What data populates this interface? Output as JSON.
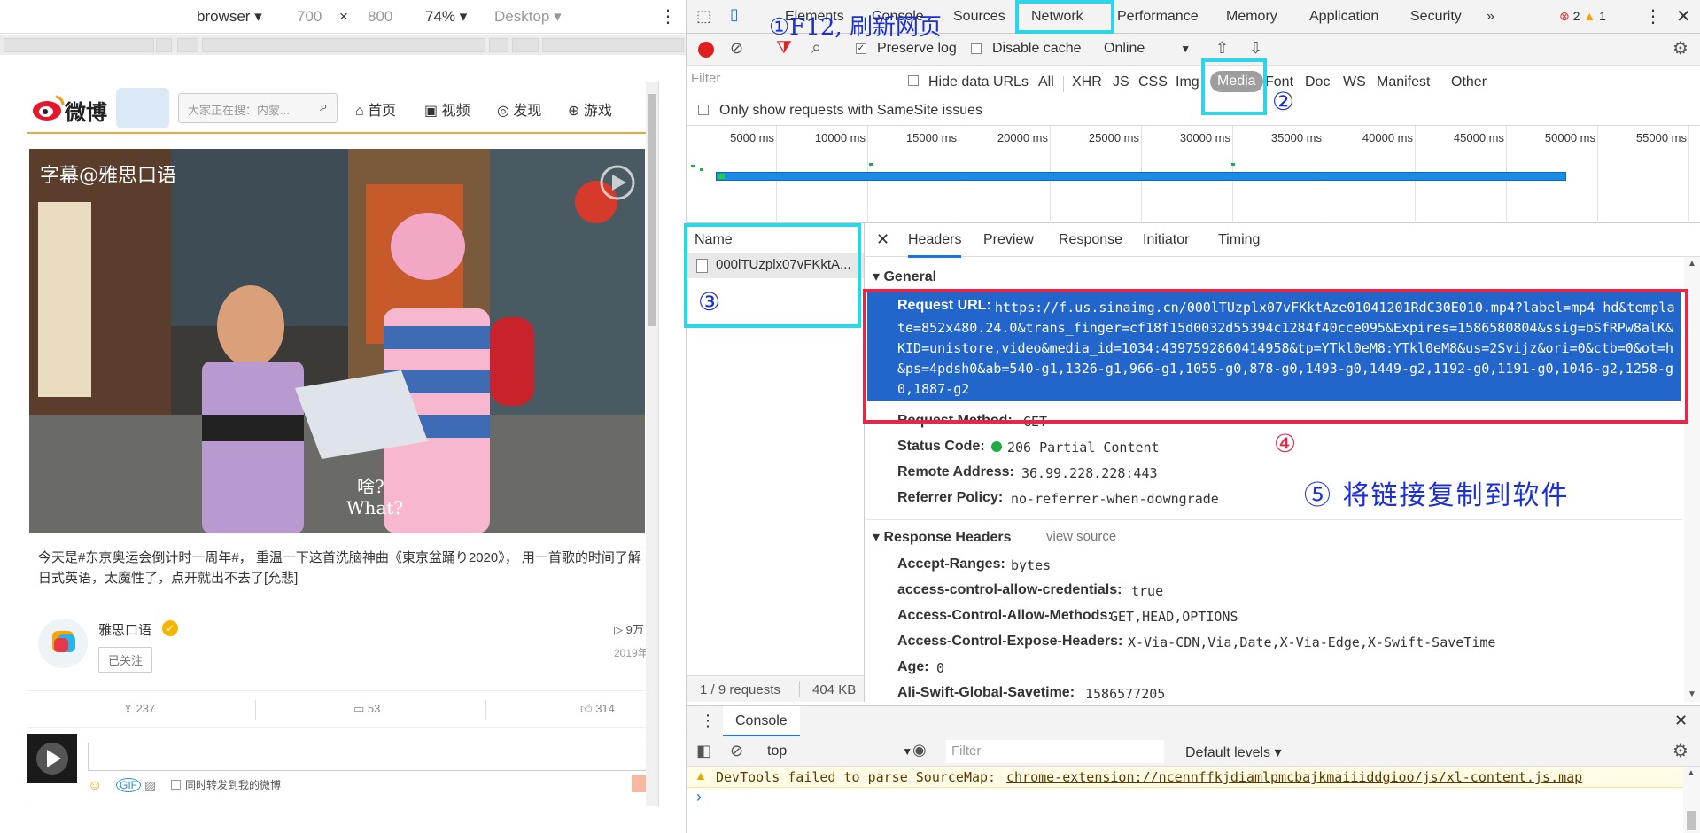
{
  "device_bar": {
    "device": "browser",
    "width": "700",
    "times": "×",
    "height": "800",
    "zoom": "74%",
    "mode": "Desktop"
  },
  "weibo": {
    "logo_text": "微博",
    "search_placeholder": "大家正在搜：内蒙...",
    "nav": [
      "首页",
      "视频",
      "发现",
      "游戏"
    ],
    "video_subtitle_top": "字幕@雅思口语",
    "video_subtitle_cn": "啥?",
    "video_subtitle_en": "What?",
    "post_text": "今天是#东京奥运会倒计时一周年#， 重温一下这首洗脑神曲《東京盆踊り2020》， 用一首歌的时间了解日式英语，太魔性了，点开就出不去了[允悲]",
    "username": "雅思口语",
    "follow_button": "已关注",
    "play_count": "▷ 9万",
    "date": "2019年",
    "repost_count": "237",
    "comment_count": "53",
    "like_count": "314",
    "sync_repost_label": "同时转发到我的微博"
  },
  "devtools": {
    "tabs": [
      "Elements",
      "Console",
      "Sources",
      "Network",
      "Performance",
      "Memory",
      "Application",
      "Security",
      "»"
    ],
    "error_count": "2",
    "warning_count": "1",
    "toolbar": {
      "preserve_log": "Preserve log",
      "disable_cache": "Disable cache",
      "throttle": "Online"
    },
    "filter": {
      "placeholder": "Filter",
      "hide_data_urls": "Hide data URLs",
      "types": [
        "All",
        "XHR",
        "JS",
        "CSS",
        "Img",
        "Media",
        "Font",
        "Doc",
        "WS",
        "Manifest",
        "Other"
      ],
      "selected_type": "Media",
      "samesite": "Only show requests with SameSite issues"
    },
    "timeline_ticks": [
      "5000 ms",
      "10000 ms",
      "15000 ms",
      "20000 ms",
      "25000 ms",
      "30000 ms",
      "35000 ms",
      "40000 ms",
      "45000 ms",
      "50000 ms",
      "55000 ms"
    ],
    "name_header": "Name",
    "request_name": "000lTUzplx07vFKktA...",
    "status_bar": {
      "requests": "1 / 9 requests",
      "size": "404 KB"
    },
    "detail_tabs": [
      "Headers",
      "Preview",
      "Response",
      "Initiator",
      "Timing"
    ],
    "general": {
      "title": "General",
      "request_url_label": "Request URL:",
      "request_url_lines": [
        "https://f.us.sinaimg.cn/000lTUzplx07vFKktAze01041201RdC30E010.mp4?label=mp4_hd&templa",
        "te=852x480.24.0&trans_finger=cf18f15d0032d55394c1284f40cce095&Expires=1586580804&ssig=bSfRPw8alK&",
        "KID=unistore,video&media_id=1034:4397592860414958&tp=YTkl0eM8:YTkl0eM8&us=2Svijz&ori=0&ctb=0&ot=h",
        "&ps=4pdsh0&ab=540-g1,1326-g1,966-g1,1055-g0,878-g0,1493-g0,1449-g2,1192-g0,1191-g0,1046-g2,1258-g",
        "0,1887-g2"
      ],
      "request_method_label": "Request Method:",
      "request_method": "GET",
      "status_code_label": "Status Code:",
      "status_code": "206 Partial Content",
      "remote_address_label": "Remote Address:",
      "remote_address": "36.99.228.228:443",
      "referrer_policy_label": "Referrer Policy:",
      "referrer_policy": "no-referrer-when-downgrade"
    },
    "response_headers": {
      "title": "Response Headers",
      "view_source": "view source",
      "rows": [
        {
          "k": "Accept-Ranges:",
          "v": "bytes"
        },
        {
          "k": "access-control-allow-credentials:",
          "v": "true"
        },
        {
          "k": "Access-Control-Allow-Methods:",
          "v": "GET,HEAD,OPTIONS"
        },
        {
          "k": "Access-Control-Expose-Headers:",
          "v": "X-Via-CDN,Via,Date,X-Via-Edge,X-Swift-SaveTime"
        },
        {
          "k": "Age:",
          "v": "0"
        },
        {
          "k": "Ali-Swift-Global-Savetime:",
          "v": "1586577205"
        }
      ]
    },
    "console": {
      "tab": "Console",
      "context": "top",
      "filter_placeholder": "Filter",
      "levels": "Default levels",
      "warning_text": "DevTools failed to parse SourceMap:",
      "warning_link": "chrome-extension://ncennffkjdiamlpmcbajkmaiiiddgioo/js/xl-content.js.map",
      "prompt": "›"
    }
  },
  "annotations": {
    "step1": "①F12, 刷新网页",
    "step2": "②",
    "step3": "③",
    "step4": "④",
    "step5": "⑤ 将链接复制到软件"
  },
  "colors": {
    "selection_blue": "#2266cc",
    "cyan_box": "#2ed4e8",
    "red_box": "#e8264a",
    "annotation_blue": "#1a2fd6",
    "record_red": "#e02020",
    "media_chip": "#9e9e9e",
    "timeline_bar": "#1a8ce8"
  }
}
